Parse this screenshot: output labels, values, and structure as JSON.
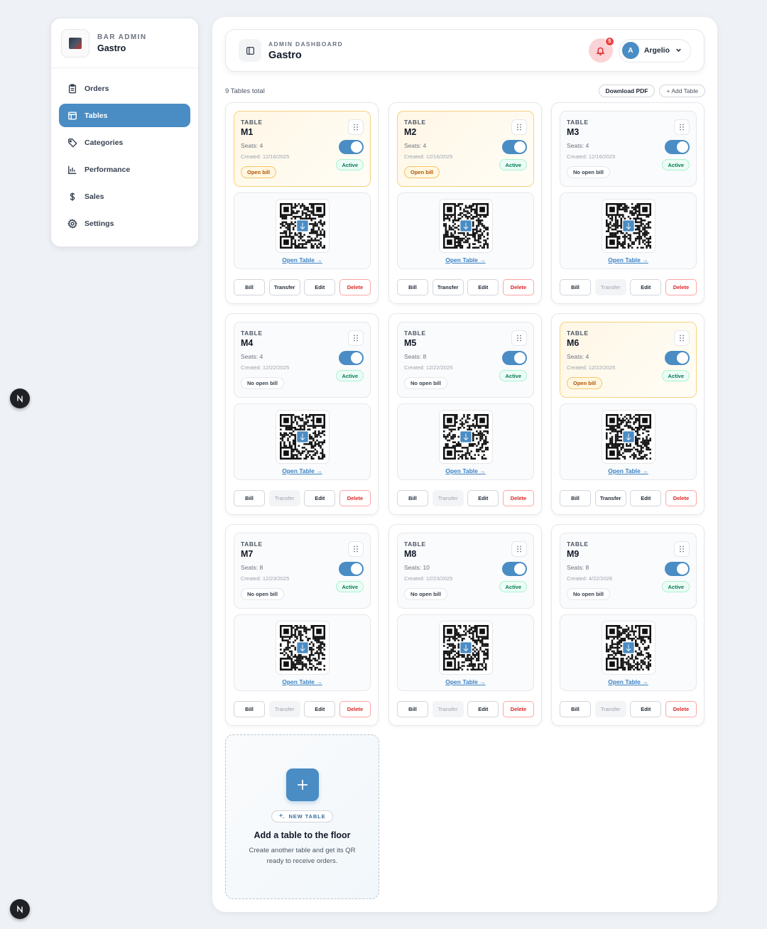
{
  "sidebar": {
    "eyebrow": "BAR ADMIN",
    "name": "Gastro",
    "items": [
      {
        "label": "Orders",
        "icon": "clipboard-icon"
      },
      {
        "label": "Tables",
        "icon": "table-icon"
      },
      {
        "label": "Categories",
        "icon": "tag-icon"
      },
      {
        "label": "Performance",
        "icon": "bar-chart-icon"
      },
      {
        "label": "Sales",
        "icon": "dollar-icon"
      },
      {
        "label": "Settings",
        "icon": "gear-icon"
      }
    ],
    "active": "Tables"
  },
  "header": {
    "eyebrow": "ADMIN DASHBOARD",
    "title": "Gastro",
    "notification_count": "5",
    "user_initial": "A",
    "user_name": "Argelio"
  },
  "toolbar": {
    "count": "9 Tables total",
    "download": "Download PDF",
    "add": "+ Add Table"
  },
  "card_labels": {
    "eyebrow": "TABLE",
    "active": "Active",
    "open_link": "Open Table →",
    "bill": "Bill",
    "transfer": "Transfer",
    "edit": "Edit",
    "delete": "Delete"
  },
  "tables": [
    {
      "name": "M1",
      "seats": "Seats: 4",
      "created": "Created: 12/16/2025",
      "bill_status": "Open bill",
      "open": true
    },
    {
      "name": "M2",
      "seats": "Seats: 4",
      "created": "Created: 12/16/2025",
      "bill_status": "Open bill",
      "open": true
    },
    {
      "name": "M3",
      "seats": "Seats: 4",
      "created": "Created: 12/16/2025",
      "bill_status": "No open bill",
      "open": false
    },
    {
      "name": "M4",
      "seats": "Seats: 4",
      "created": "Created: 12/22/2025",
      "bill_status": "No open bill",
      "open": false
    },
    {
      "name": "M5",
      "seats": "Seats: 8",
      "created": "Created: 12/22/2025",
      "bill_status": "No open bill",
      "open": false
    },
    {
      "name": "M6",
      "seats": "Seats: 4",
      "created": "Created: 12/22/2025",
      "bill_status": "Open bill",
      "open": true
    },
    {
      "name": "M7",
      "seats": "Seats: 8",
      "created": "Created: 12/23/2025",
      "bill_status": "No open bill",
      "open": false
    },
    {
      "name": "M8",
      "seats": "Seats: 10",
      "created": "Created: 12/23/2025",
      "bill_status": "No open bill",
      "open": false
    },
    {
      "name": "M9",
      "seats": "Seats: 8",
      "created": "Created: 4/22/2026",
      "bill_status": "No open bill",
      "open": false
    }
  ],
  "add_card": {
    "pill": "NEW TABLE",
    "title": "Add a table to the floor",
    "description": "Create another table and get its QR ready to receive orders."
  },
  "colors": {
    "accent": "#4a8cc4",
    "danger": "#dc2626",
    "success": "#047857",
    "warning": "#b45309"
  }
}
